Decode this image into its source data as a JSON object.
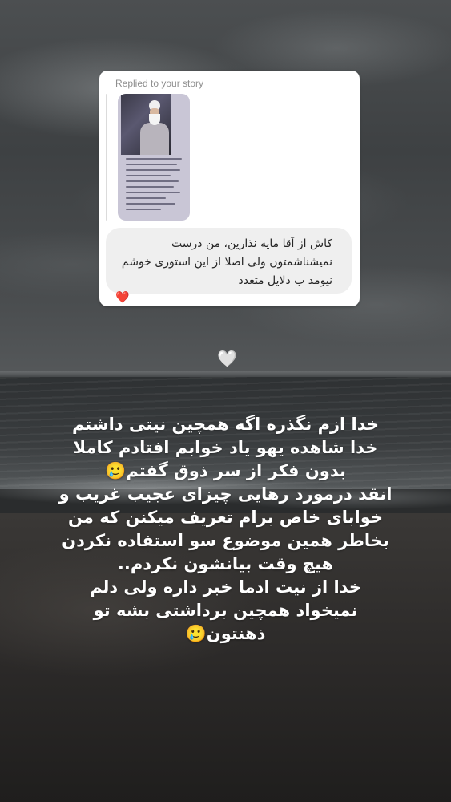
{
  "story_reply": {
    "replied_label": "Replied to your story",
    "story_thumbnail": {
      "icon": "story-preview-thumbnail"
    },
    "message": "کاش از آقا مایه نذارین، من درست\nنمیشناشمتون ولی اصلا از این استوری خوشم\nنیومد ب دلایل متعدد",
    "reaction": "❤️"
  },
  "decor": {
    "heart": "🤍"
  },
  "caption": {
    "text": "خدا ازم نگذره اگه همچین نیتی داشتم\nخدا شاهده یهو یاد خوابم افتادم کاملا\nبدون فکر از سر ذوق گفتم🥲\nانقد درمورد رهایی چیزای عجیب غریب و\nخوابای خاص برام تعریف میکنن که من\nبخاطر همین موضوع سو استفاده نکردن\nهیچ وقت بیانشون نکردم..\nخدا از نیت ادما خبر داره ولی دلم\nنمیخواد همچین برداشتی بشه تو\nذهنتون🥲"
  },
  "colors": {
    "card_bg": "#ffffff",
    "bubble_bg": "#efefef",
    "label_gray": "#8e8e8e",
    "reaction_red": "#ed1c38",
    "caption_text": "#ffffff"
  }
}
